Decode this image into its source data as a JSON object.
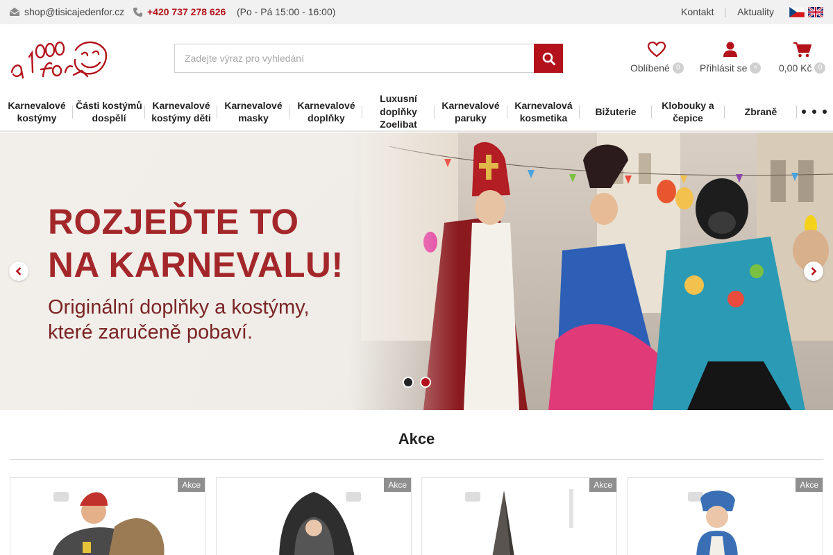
{
  "topbar": {
    "email": "shop@tisicajedenfor.cz",
    "phone": "+420 737 278 626",
    "hours": "(Po - Pá 15:00 - 16:00)",
    "links": [
      "Kontakt",
      "Aktuality"
    ]
  },
  "logo": {
    "text": "1000 a 1 fór"
  },
  "search": {
    "placeholder": "Zadejte výraz pro vyhledání"
  },
  "header": {
    "favorites_label": "Oblíbené",
    "favorites_count": "0",
    "login_label": "Přihlásit se",
    "login_badge": "×",
    "cart_label": "0,00 Kč",
    "cart_count": "0"
  },
  "nav": {
    "items": [
      "Karnevalové kostýmy",
      "Části kostýmů dospělí",
      "Karnevalové kostýmy děti",
      "Karnevalové masky",
      "Karnevalové doplňky",
      "Luxusní doplňky Zoelibat",
      "Karnevalové paruky",
      "Karnevalová kosmetika",
      "Bižuterie",
      "Klobouky a čepice",
      "Zbraně"
    ]
  },
  "banner": {
    "headline_line1": "ROZJEĎTE TO",
    "headline_line2": "NA KARNEVALU!",
    "subline_line1": "Originální doplňky a kostýmy,",
    "subline_line2": "které zaručeně pobaví."
  },
  "section": {
    "title": "Akce"
  },
  "products": [
    {
      "tag": "Akce"
    },
    {
      "tag": "Akce"
    },
    {
      "tag": "Akce"
    },
    {
      "tag": "Akce"
    }
  ],
  "colors": {
    "accent": "#b3121b",
    "topbar": "#f1f1f1",
    "headline": "#a3272a"
  },
  "icons": [
    "envelope-icon",
    "phone-icon",
    "search-icon",
    "heart-icon",
    "user-icon",
    "cart-icon",
    "chevron-left-icon",
    "chevron-right-icon",
    "more-icon"
  ]
}
